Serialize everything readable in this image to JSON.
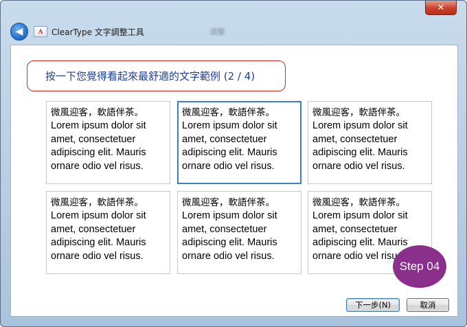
{
  "window": {
    "title": "ClearType 文字調整工具",
    "blurred_text": "調整",
    "close_glyph": "✕",
    "back_glyph": "◀",
    "app_icon_text": "A"
  },
  "prompt": "按一下您覺得看起來最舒適的文字範例 (2 / 4)",
  "samples": [
    {
      "cjk": "微風迎客，軟語伴茶。",
      "latin": "Lorem ipsum dolor sit amet, consectetuer adipiscing elit. Mauris ornare odio vel risus.",
      "selected": false
    },
    {
      "cjk": "微風迎客，軟語伴茶。",
      "latin": "Lorem ipsum dolor sit amet, consectetuer adipiscing elit. Mauris ornare odio vel risus.",
      "selected": true
    },
    {
      "cjk": "微風迎客，軟語伴茶。",
      "latin": "Lorem ipsum dolor sit amet, consectetuer adipiscing elit. Mauris ornare odio vel risus.",
      "selected": false
    },
    {
      "cjk": "微風迎客，軟語伴茶。",
      "latin": "Lorem ipsum dolor sit amet, consectetuer adipiscing elit. Mauris ornare odio vel risus.",
      "selected": false
    },
    {
      "cjk": "微風迎客，軟語伴茶。",
      "latin": "Lorem ipsum dolor sit amet, consectetuer adipiscing elit. Mauris ornare odio vel risus.",
      "selected": false
    },
    {
      "cjk": "微風迎客，軟語伴茶。",
      "latin": "Lorem ipsum dolor sit amet, consectetuer adipiscing elit. Mauris ornare odio vel risus.",
      "selected": false
    }
  ],
  "buttons": {
    "next_label": "下一步(N)",
    "cancel_label": "取消"
  },
  "step_badge": "Step 04",
  "colors": {
    "prompt_border": "#d12a2a",
    "prompt_text": "#1f3f94",
    "selected_border": "#3b7fcb",
    "badge": "#8a2f8c"
  }
}
